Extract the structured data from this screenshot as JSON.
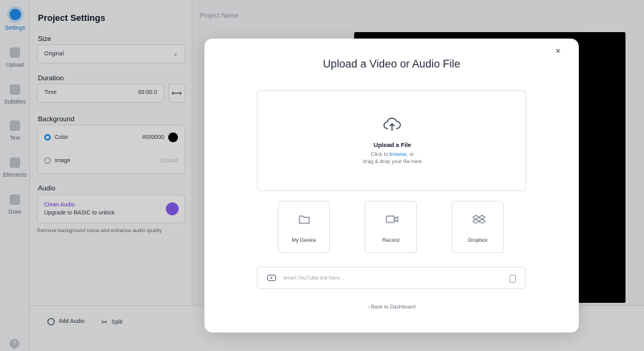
{
  "rail": {
    "items": [
      {
        "label": "Settings",
        "active": true
      },
      {
        "label": "Upload"
      },
      {
        "label": "Subtitles"
      },
      {
        "label": "Text"
      },
      {
        "label": "Elements"
      },
      {
        "label": "Draw"
      }
    ],
    "help_label": "?"
  },
  "panel": {
    "title": "Project Settings",
    "size": {
      "label": "Size",
      "value": "Original",
      "chevron": "⌄"
    },
    "duration": {
      "label": "Duration",
      "field_label": "Time",
      "value": "00:00.0",
      "toggle": "⟷"
    },
    "background": {
      "label": "Background",
      "color_label": "Color",
      "color_value": "#000000",
      "image_label": "Image",
      "upload_label": "Upload"
    },
    "audio": {
      "label": "Audio",
      "title": "Clean Audio",
      "subtitle": "Upgrade to BASIC to unlock",
      "note": "Remove background noise and enhance audio quality"
    }
  },
  "bottombar": {
    "add_audio": "Add Audio",
    "split": "Split"
  },
  "canvas": {
    "project_name": "Project Name",
    "background_color": "#000000"
  },
  "modal": {
    "close_label": "×",
    "title": "Upload a Video or Audio File",
    "drop_title": "Upload a File",
    "drop_text_before": "Click to ",
    "drop_link": "browse",
    "drop_text_after": ", or",
    "drop_text_line2": "drag & drop your file here",
    "sources": [
      {
        "label": "My Device",
        "icon": "folder-icon"
      },
      {
        "label": "Record",
        "icon": "video-camera-icon"
      },
      {
        "label": "Dropbox",
        "icon": "dropbox-icon"
      }
    ],
    "youtube_placeholder": "Insert YouTube link here...",
    "back_label": "‹  Back to Dashboard"
  },
  "colors": {
    "accent": "#1f8ded",
    "link": "#1d7ed8",
    "purple": "#8b5cf6"
  }
}
